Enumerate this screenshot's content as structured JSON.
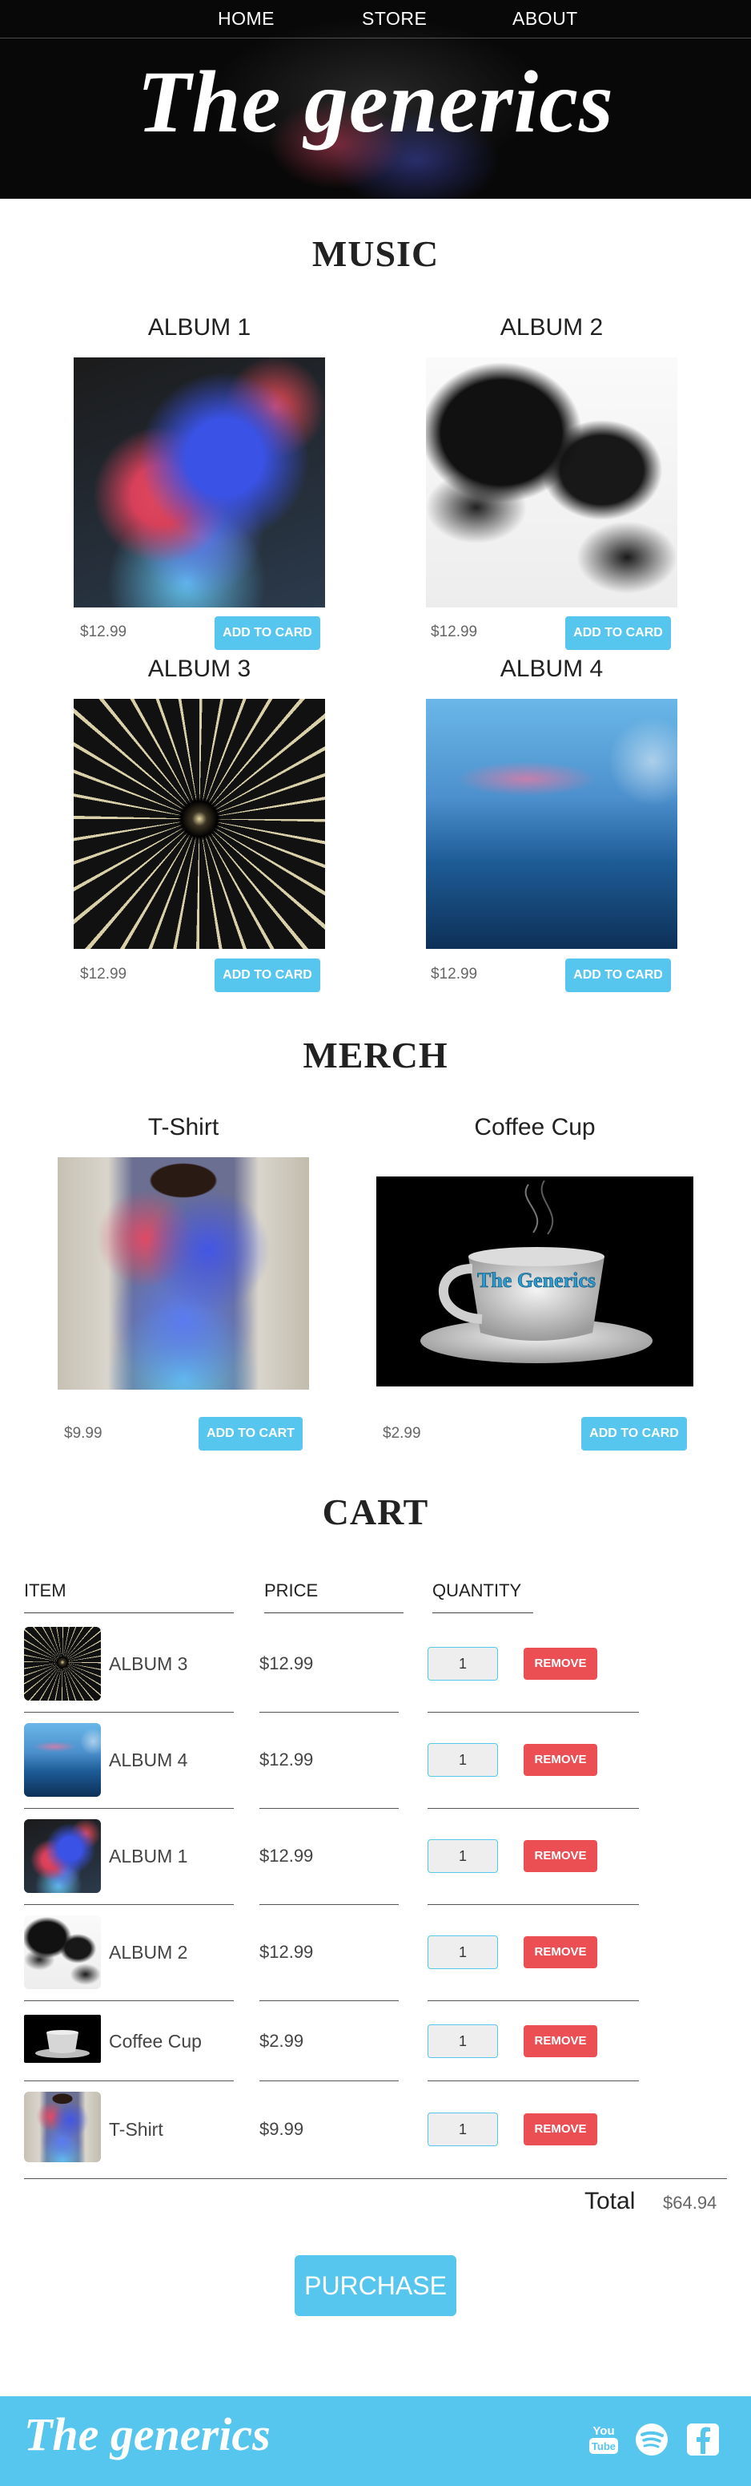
{
  "nav": {
    "home": "HOME",
    "store": "STORE",
    "about": "ABOUT"
  },
  "brand": "The generics",
  "music": {
    "title": "MUSIC",
    "albums": [
      {
        "title": "ALBUM 1",
        "price": "$12.99",
        "button": "ADD TO CARD"
      },
      {
        "title": "ALBUM 2",
        "price": "$12.99",
        "button": "ADD TO CARD"
      },
      {
        "title": "ALBUM 3",
        "price": "$12.99",
        "button": "ADD TO CARD"
      },
      {
        "title": "ALBUM 4",
        "price": "$12.99",
        "button": "ADD TO CARD"
      }
    ]
  },
  "merch": {
    "title": "MERCH",
    "items": [
      {
        "title": "T-Shirt",
        "price": "$9.99",
        "button": "ADD TO CART"
      },
      {
        "title": "Coffee Cup",
        "price": "$2.99",
        "button": "ADD TO CARD",
        "cup_text": "The Generics"
      }
    ]
  },
  "cart": {
    "title": "CART",
    "headers": {
      "item": "ITEM",
      "price": "PRICE",
      "quantity": "QUANTITY"
    },
    "rows": [
      {
        "name": "ALBUM 3",
        "price": "$12.99",
        "qty": "1",
        "remove": "REMOVE"
      },
      {
        "name": "ALBUM 4",
        "price": "$12.99",
        "qty": "1",
        "remove": "REMOVE"
      },
      {
        "name": "ALBUM 1",
        "price": "$12.99",
        "qty": "1",
        "remove": "REMOVE"
      },
      {
        "name": "ALBUM 2",
        "price": "$12.99",
        "qty": "1",
        "remove": "REMOVE"
      },
      {
        "name": "Coffee Cup",
        "price": "$2.99",
        "qty": "1",
        "remove": "REMOVE"
      },
      {
        "name": "T-Shirt",
        "price": "$9.99",
        "qty": "1",
        "remove": "REMOVE"
      }
    ],
    "total_label": "Total",
    "total_value": "$64.94",
    "purchase": "PURCHASE"
  },
  "footer": {
    "brand": "The generics",
    "social": [
      "youtube-icon",
      "spotify-icon",
      "facebook-icon"
    ]
  },
  "colors": {
    "accent": "#56c6ee",
    "remove": "#eb4f53"
  }
}
